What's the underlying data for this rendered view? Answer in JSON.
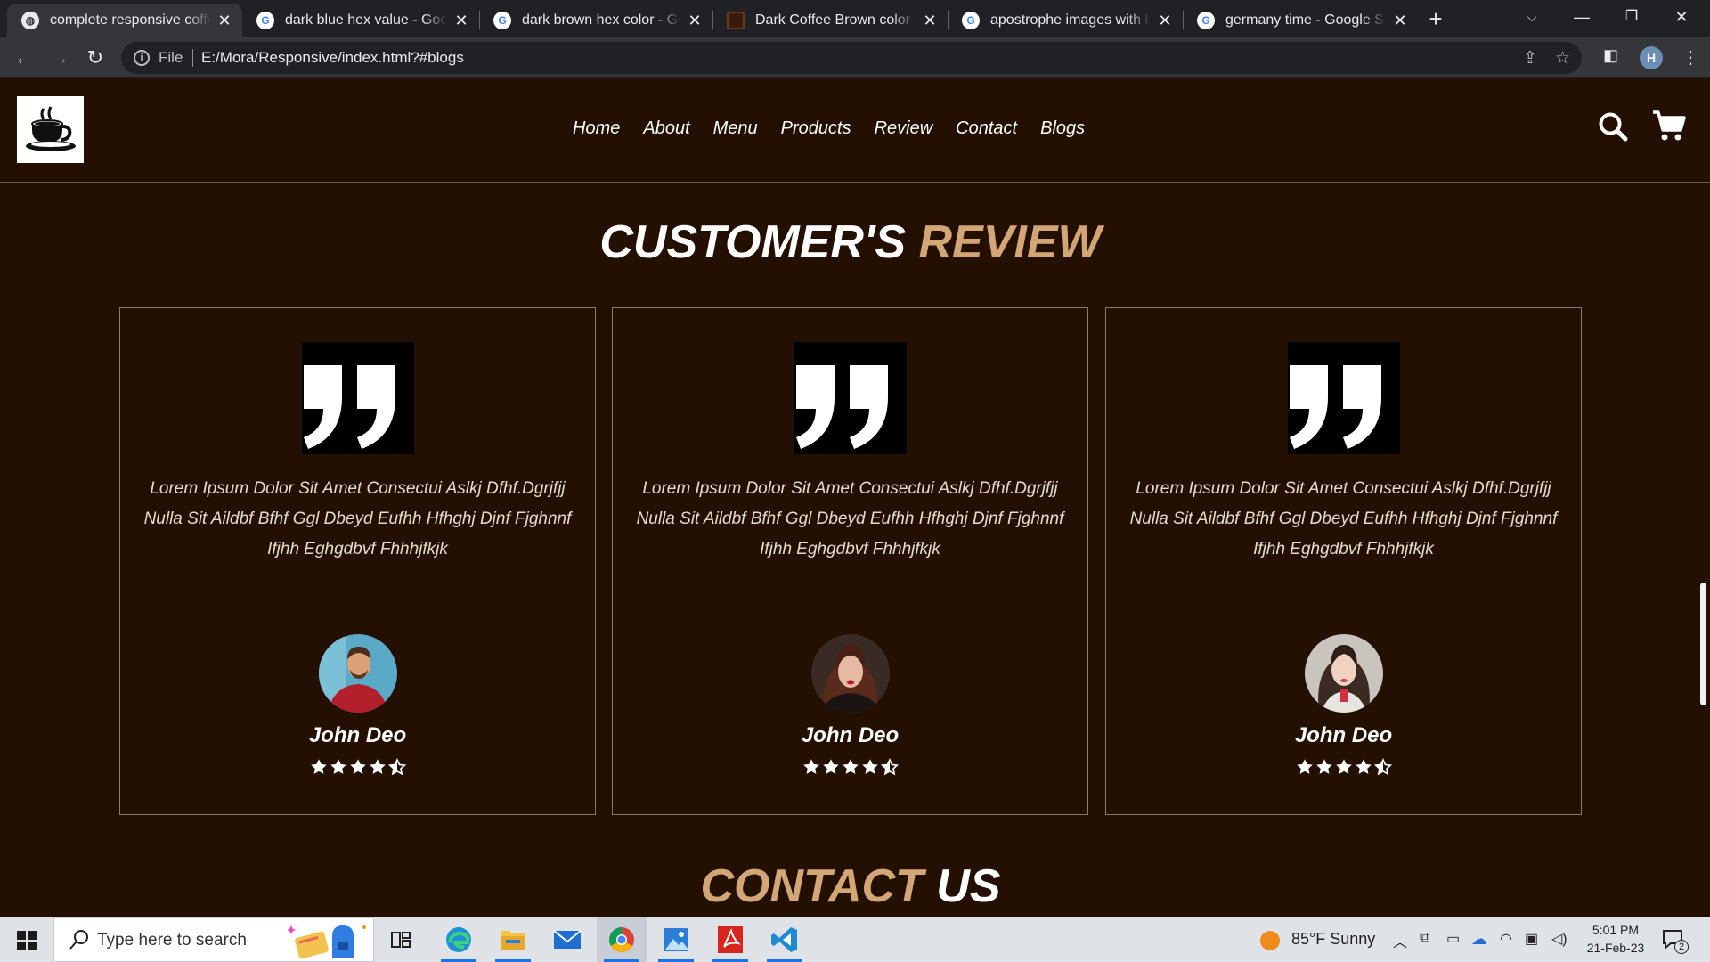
{
  "browser": {
    "tabs": [
      {
        "title": "complete responsive coffee shop website",
        "icon": "globe-icon",
        "active": true
      },
      {
        "title": "dark blue hex value - Google Search",
        "icon": "google-icon",
        "active": false
      },
      {
        "title": "dark brown hex color - Google Search",
        "icon": "google-icon",
        "active": false
      },
      {
        "title": "Dark Coffee Brown color hex code",
        "icon": "dark-coffee-favicon",
        "active": false
      },
      {
        "title": "apostrophe images with bu",
        "icon": "google-icon",
        "active": false
      },
      {
        "title": "germany time - Google Search",
        "icon": "google-icon",
        "active": false
      }
    ],
    "address": {
      "scheme_label": "File",
      "url": "E:/Mora/Responsive/index.html?#blogs"
    },
    "profile_initial": "H"
  },
  "site": {
    "nav": [
      "Home",
      "About",
      "Menu",
      "Products",
      "Review",
      "Contact",
      "Blogs"
    ],
    "review_section": {
      "title_part1": "CUSTOMER'S",
      "title_part2": "REVIEW",
      "cards": [
        {
          "text": "Lorem Ipsum Dolor Sit Amet Consectui Aslkj Dfhf.Dgrjfjj Nulla Sit Aildbf Bfhf Ggl Dbeyd Eufhh Hfhghj Djnf Fjghnnf Ifjhh Eghgdbvf Fhhhjfkjk",
          "name": "John Deo",
          "rating": 4.5
        },
        {
          "text": "Lorem Ipsum Dolor Sit Amet Consectui Aslkj Dfhf.Dgrjfjj Nulla Sit Aildbf Bfhf Ggl Dbeyd Eufhh Hfhghj Djnf Fjghnnf Ifjhh Eghgdbvf Fhhhjfkjk",
          "name": "John Deo",
          "rating": 4.5
        },
        {
          "text": "Lorem Ipsum Dolor Sit Amet Consectui Aslkj Dfhf.Dgrjfjj Nulla Sit Aildbf Bfhf Ggl Dbeyd Eufhh Hfhghj Djnf Fjghnnf Ifjhh Eghgdbvf Fhhhjfkjk",
          "name": "John Deo",
          "rating": 4.5
        }
      ]
    },
    "contact_section": {
      "title_part1": "CONTACT",
      "title_part2": "US"
    },
    "colors": {
      "background": "#231002",
      "accent": "#d3a676",
      "text": "#ffffff"
    }
  },
  "taskbar": {
    "search_placeholder": "Type here to search",
    "weather": "85°F  Sunny",
    "time": "5:01 PM",
    "date": "21-Feb-23",
    "notification_count": "2"
  }
}
